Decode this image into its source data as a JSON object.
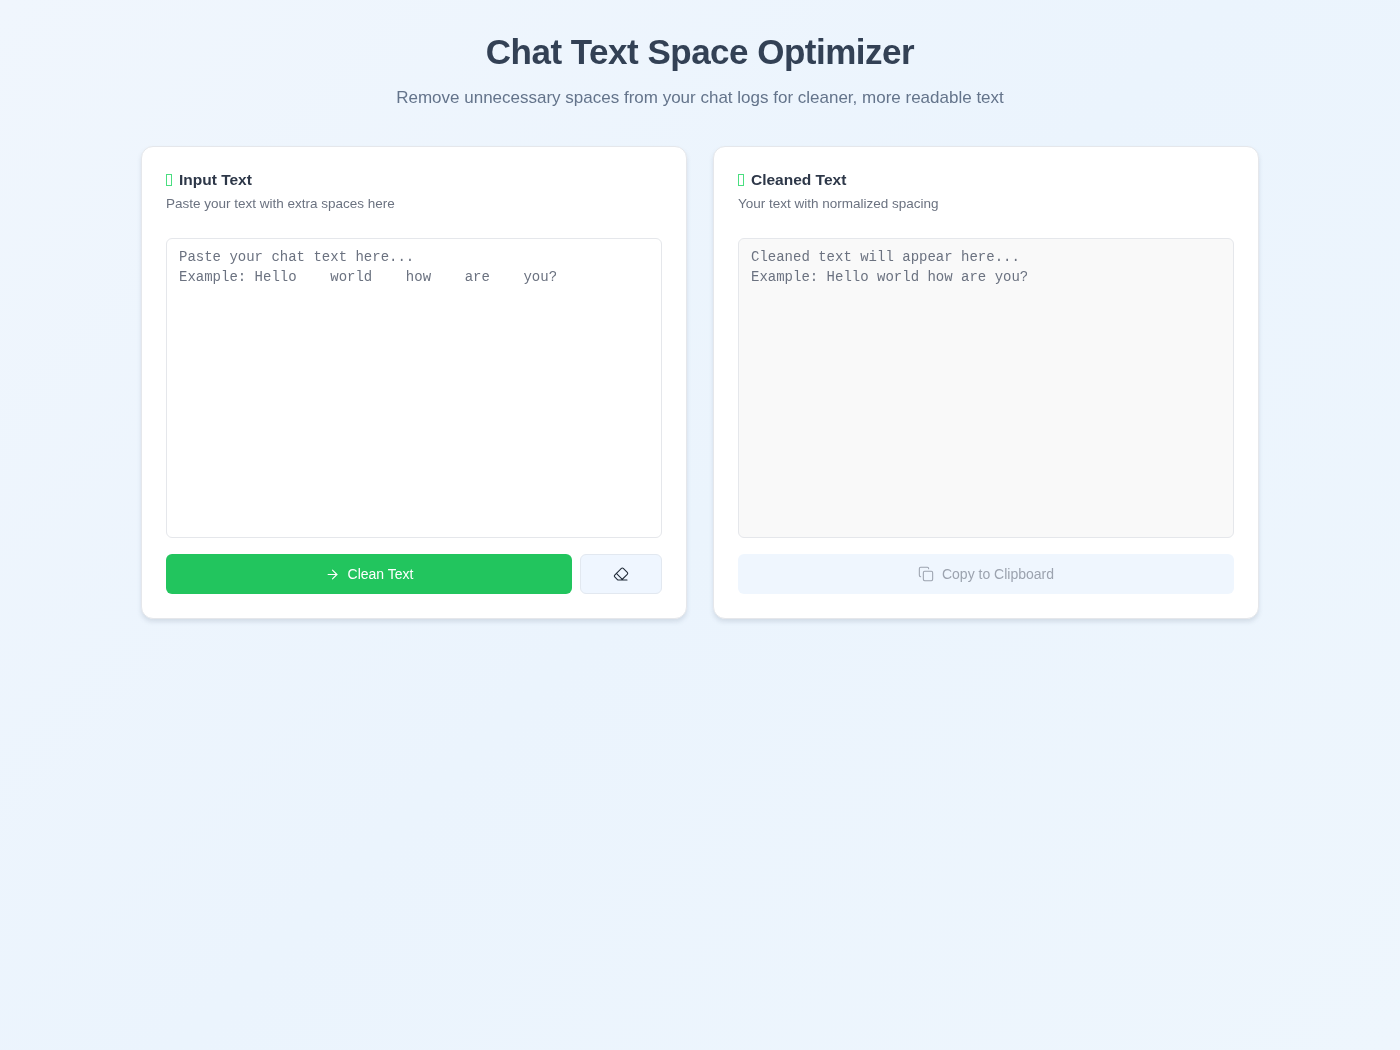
{
  "header": {
    "title": "Chat Text Space Optimizer",
    "subtitle": "Remove unnecessary spaces from your chat logs for cleaner, more readable text"
  },
  "panels": [
    {
      "kind": "input",
      "title": "Input Text",
      "description": "Paste your text with extra spaces here",
      "field": {
        "placeholder": "Paste your chat text here...\nExample: Hello    world    how    are    you?"
      },
      "actions": [
        {
          "kind": "clean",
          "label": "Clean Text",
          "disabled": false
        },
        {
          "kind": "clear",
          "disabled": false
        }
      ]
    },
    {
      "kind": "output",
      "title": "Cleaned Text",
      "description": "Your text with normalized spacing",
      "field": {
        "placeholder": "Cleaned text will appear here...\nExample: Hello world how are you?"
      },
      "actions": [
        {
          "kind": "copy",
          "label": "Copy to Clipboard",
          "disabled": true
        }
      ]
    }
  ]
}
